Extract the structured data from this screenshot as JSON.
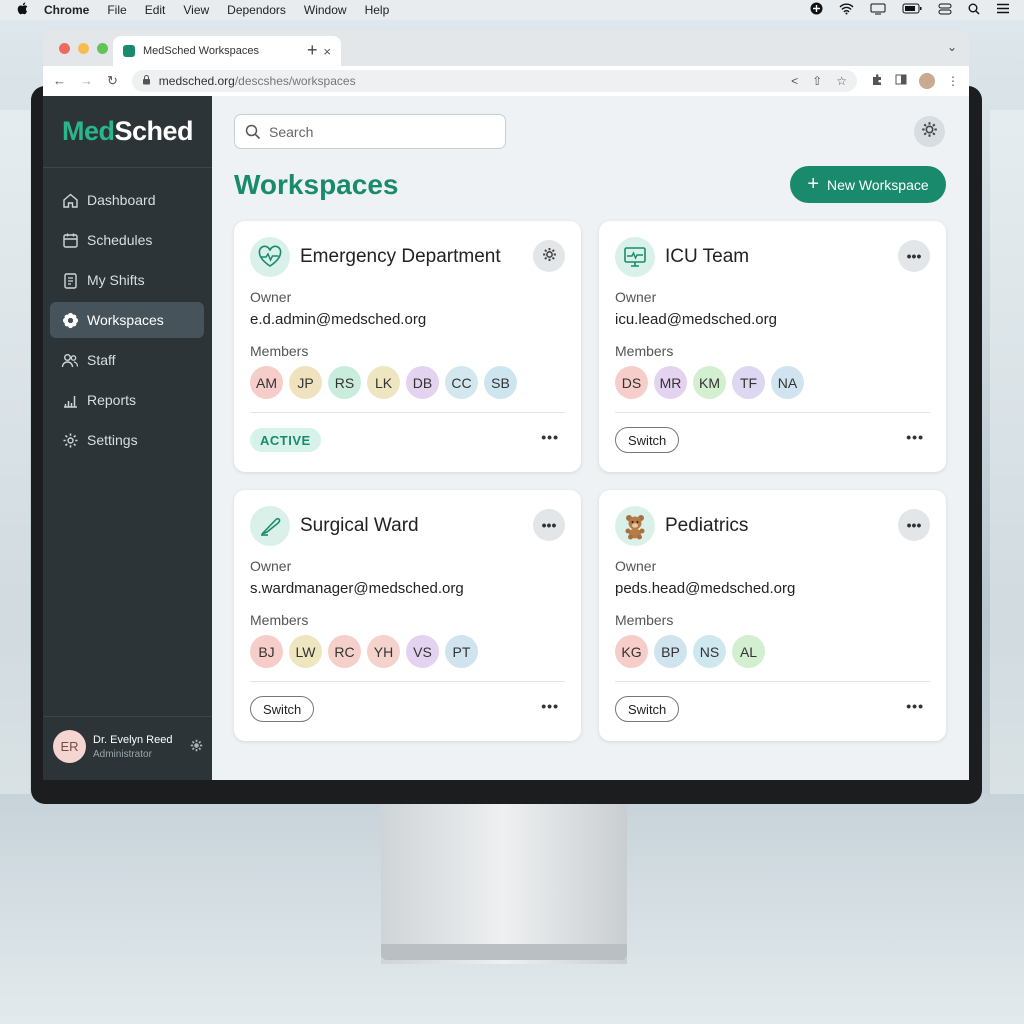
{
  "menubar": {
    "apple": "",
    "app_name": "Chrome",
    "items": [
      "File",
      "Edit",
      "View",
      "Dependors",
      "Window",
      "Help"
    ]
  },
  "browser": {
    "tab_title": "MedSched Workspaces",
    "url_host": "medsched.org",
    "url_path": "/descshes/workspaces"
  },
  "app": {
    "logo_part1": "Med",
    "logo_part2": "Sched",
    "nav": [
      {
        "label": "Dashboard",
        "icon": "home-icon"
      },
      {
        "label": "Schedules",
        "icon": "calendar-icon"
      },
      {
        "label": "My Shifts",
        "icon": "clipboard-icon"
      },
      {
        "label": "Workspaces",
        "icon": "workspaces-icon",
        "active": true
      },
      {
        "label": "Staff",
        "icon": "people-icon"
      },
      {
        "label": "Reports",
        "icon": "bar-chart-icon"
      },
      {
        "label": "Settings",
        "icon": "gear-icon"
      }
    ],
    "user": {
      "initials": "ER",
      "name": "Dr. Evelyn Reed",
      "role": "Administrator"
    },
    "accent": "#1a8a6c",
    "sidebar_bg": "#2c3438"
  },
  "main": {
    "search_placeholder": "Search",
    "title": "Workspaces",
    "new_button": "New Workspace"
  },
  "workspaces": [
    {
      "title": "Emergency Department",
      "icon": "heart-pulse-icon",
      "owner_label": "Owner",
      "owner": "e.d.admin@medsched.org",
      "members_label": "Members",
      "members": [
        "AM",
        "JP",
        "RS",
        "LK",
        "DB",
        "CC",
        "SB"
      ],
      "status": "ACTIVE"
    },
    {
      "title": "ICU Team",
      "icon": "monitor-icon",
      "owner_label": "Owner",
      "owner": "icu.lead@medsched.org",
      "members_label": "Members",
      "members": [
        "DS",
        "MR",
        "KM",
        "TF",
        "NA"
      ],
      "action": "Switch"
    },
    {
      "title": "Surgical Ward",
      "icon": "scalpel-icon",
      "owner_label": "Owner",
      "owner": "s.wardmanager@medsched.org",
      "members_label": "Members",
      "members": [
        "BJ",
        "LW",
        "RC",
        "YH",
        "VS",
        "PT"
      ],
      "action": "Switch"
    },
    {
      "title": "Pediatrics",
      "icon": "teddy-bear-icon",
      "owner_label": "Owner",
      "owner": "peds.head@medsched.org",
      "members_label": "Members",
      "members": [
        "KG",
        "BP",
        "NS",
        "AL"
      ],
      "action": "Switch"
    }
  ]
}
